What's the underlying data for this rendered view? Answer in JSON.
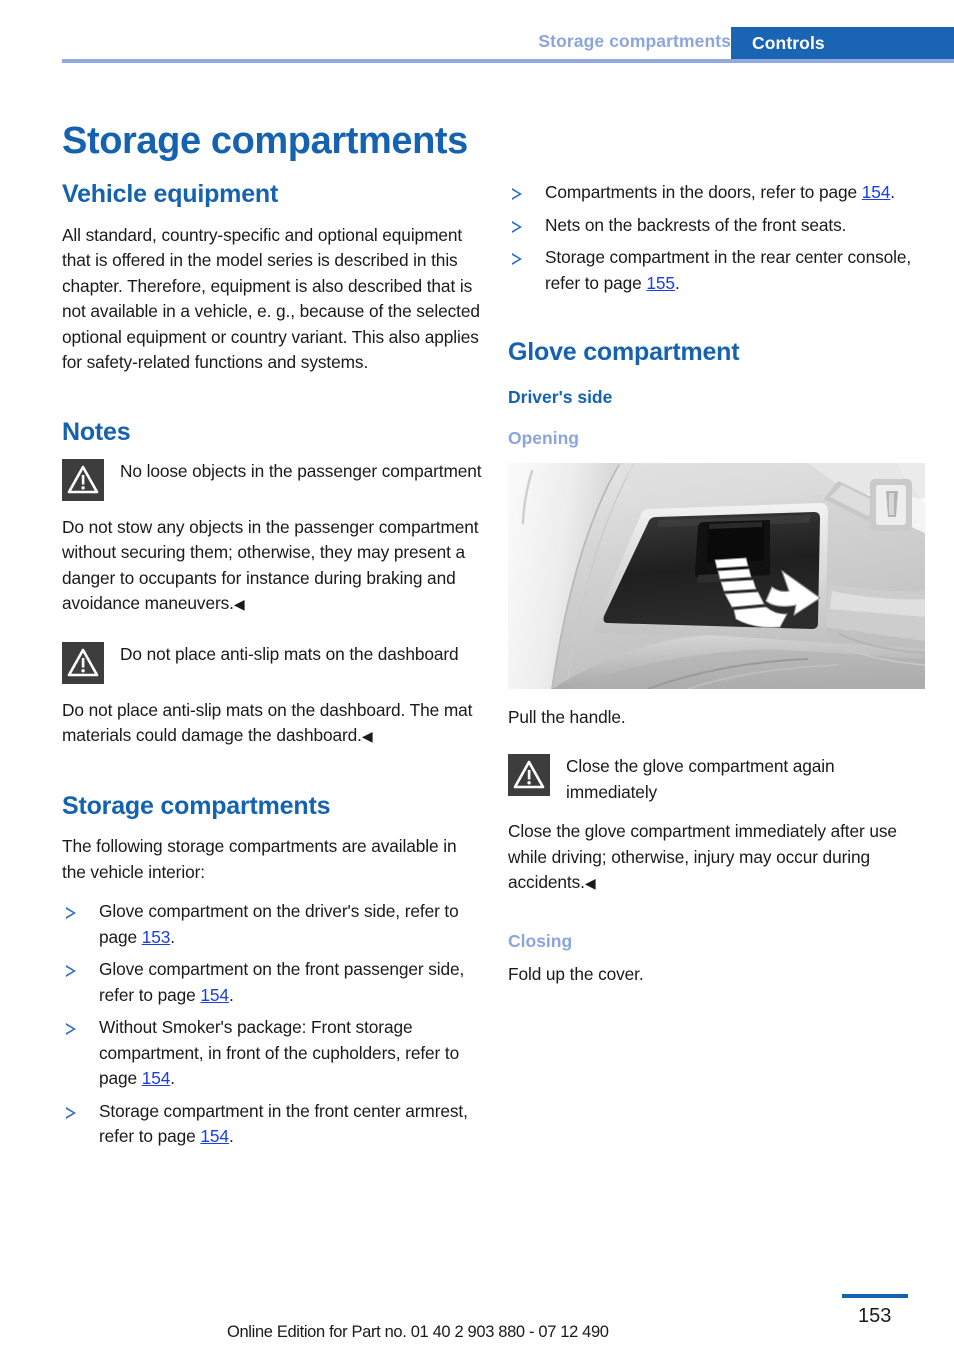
{
  "header": {
    "section_label": "Storage compartments",
    "chapter_label": "Controls"
  },
  "page_title": "Storage compartments",
  "left_column": {
    "vehicle_equipment": {
      "heading": "Vehicle equipment",
      "paragraph": "All standard, country-specific and optional equipment that is offered in the model series is described in this chapter. Therefore, equipment is also described that is not available in a vehicle, e. g., because of the selected optional equipment or country variant. This also applies for safety-related functions and systems."
    },
    "notes": {
      "heading": "Notes",
      "warning_1": {
        "title": "No loose objects in the passenger compartment",
        "body": "Do not stow any objects in the passenger compartment without securing them; otherwise, they may present a danger to occupants for instance during braking and avoidance maneuvers.",
        "endmark": "◀"
      },
      "warning_2": {
        "title": "Do not place anti-slip mats on the dashboard",
        "body": "Do not place anti-slip mats on the dashboard. The mat materials could damage the dashboard.",
        "endmark": "◀"
      }
    },
    "storage_compartments": {
      "heading": "Storage compartments",
      "intro": "The following storage compartments are available in the vehicle interior:",
      "bullets": [
        {
          "text_before": "Glove compartment on the driver's side, refer to page ",
          "ref": "153",
          "text_after": "."
        },
        {
          "text_before": "Glove compartment on the front passenger side, refer to page ",
          "ref": "154",
          "text_after": "."
        },
        {
          "text_before": "Without Smoker's package: Front storage compartment, in front of the cupholders, refer to page ",
          "ref": "154",
          "text_after": "."
        },
        {
          "text_before": "Storage compartment in the front center armrest, refer to page ",
          "ref": "154",
          "text_after": "."
        }
      ]
    }
  },
  "right_column": {
    "continued_bullets": [
      {
        "text_before": "Compartments in the doors, refer to page ",
        "ref": "154",
        "text_after": "."
      },
      {
        "text_before": "Nets on the backrests of the front seats.",
        "ref": "",
        "text_after": ""
      },
      {
        "text_before": "Storage compartment in the rear center console, refer to page ",
        "ref": "155",
        "text_after": "."
      }
    ],
    "glove_compartment": {
      "heading": "Glove compartment",
      "subheading": "Driver's side",
      "opening": {
        "label": "Opening",
        "figure_caption": "Pull the handle.",
        "figure_alt": "glove-compartment-dashboard-photo",
        "warning": {
          "title": "Close the glove compartment again immediately",
          "body": "Close the glove compartment immediately after use while driving; otherwise, injury may occur during accidents.",
          "endmark": "◀"
        }
      },
      "closing": {
        "label": "Closing",
        "text": "Fold up the cover."
      }
    }
  },
  "footer": {
    "edition": "Online Edition for Part no. 01 40 2 903 880 - 07 12 490",
    "page_number": "153"
  },
  "colors": {
    "heading_blue": "#1562b0",
    "light_blue": "#8ba5dd",
    "chapter_tab_blue": "#1a64b4",
    "reference_blue": "#1a3fe0",
    "warning_icon_bg": "#3d3d3d",
    "rule_blue": "#92aae0"
  }
}
